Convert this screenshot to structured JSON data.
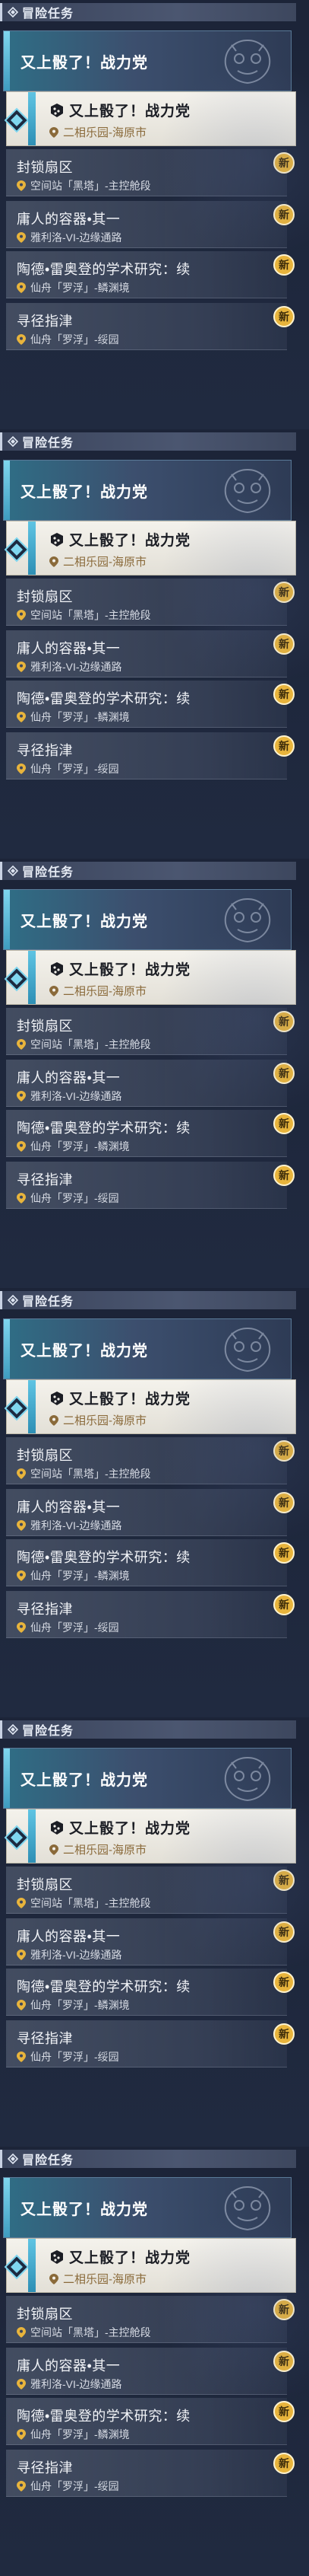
{
  "header": {
    "title": "冒险任务"
  },
  "banner": {
    "title": "又上骰了！战力党"
  },
  "selected": {
    "title": "又上骰了！战力党",
    "location": "二相乐园-海原市"
  },
  "entries": [
    {
      "title": "封锁扇区",
      "location": "空间站「黑塔」-主控舱段",
      "new": true
    },
    {
      "title": "庸人的容器•其一",
      "location": "雅利洛-VI-边缘通路",
      "new": true
    },
    {
      "title": "陶德•雷奥登的学术研究：续",
      "location": "仙舟「罗浮」-鳞渊境",
      "new": true
    },
    {
      "title": "寻径指津",
      "location": "仙舟「罗浮」-绥园",
      "new": true
    }
  ],
  "badge": {
    "label": "新"
  },
  "colors": {
    "accent": "#3f9cc0",
    "badge": "#e8b43c",
    "location_gold": "#8a6a3a"
  },
  "icons": {
    "header": "quest-diamond-icon",
    "location": "map-pin-icon",
    "quest": "dice-quest-icon",
    "emblem": "faction-emblem-icon"
  }
}
